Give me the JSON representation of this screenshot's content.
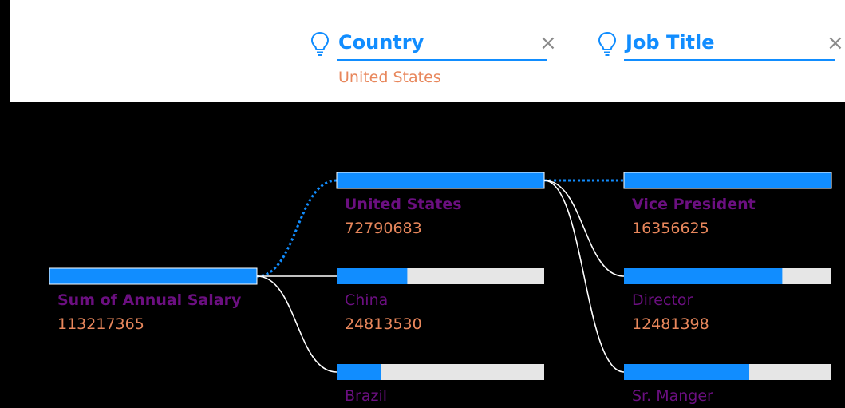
{
  "header": {
    "levels": [
      {
        "title": "Country",
        "selected": "United States",
        "close": "×",
        "icon": "lightbulb-icon"
      },
      {
        "title": "Job Title",
        "selected": "",
        "close": "×",
        "icon": "lightbulb-icon"
      }
    ]
  },
  "colors": {
    "bar_fill": "#118DFF",
    "bar_track": "#E6E6E6",
    "name": "#6B0F80",
    "value": "#E8875C",
    "header_accent": "#118DFF",
    "connector": "#FFFFFF"
  },
  "chart_data": {
    "type": "decomposition-tree",
    "root": {
      "name": "Sum of Annual Salary",
      "value": 113217365,
      "value_text": "113217365"
    },
    "levels": [
      {
        "field": "Country",
        "nodes": [
          {
            "name": "United States",
            "value": 72790683,
            "value_text": "72790683",
            "selected": true,
            "bar_fill": 1.0
          },
          {
            "name": "China",
            "value": 24813530,
            "value_text": "24813530",
            "selected": false,
            "bar_fill": 0.34
          },
          {
            "name": "Brazil",
            "value": null,
            "value_text": "",
            "selected": false,
            "bar_fill": 0.215
          }
        ]
      },
      {
        "field": "Job Title",
        "nodes": [
          {
            "name": "Vice President",
            "value": 16356625,
            "value_text": "16356625",
            "selected": true,
            "bar_fill": 1.0
          },
          {
            "name": "Director",
            "value": 12481398,
            "value_text": "12481398",
            "selected": false,
            "bar_fill": 0.763
          },
          {
            "name": "Sr. Manger",
            "value": null,
            "value_text": "",
            "selected": false,
            "bar_fill": 0.604
          }
        ]
      }
    ]
  }
}
